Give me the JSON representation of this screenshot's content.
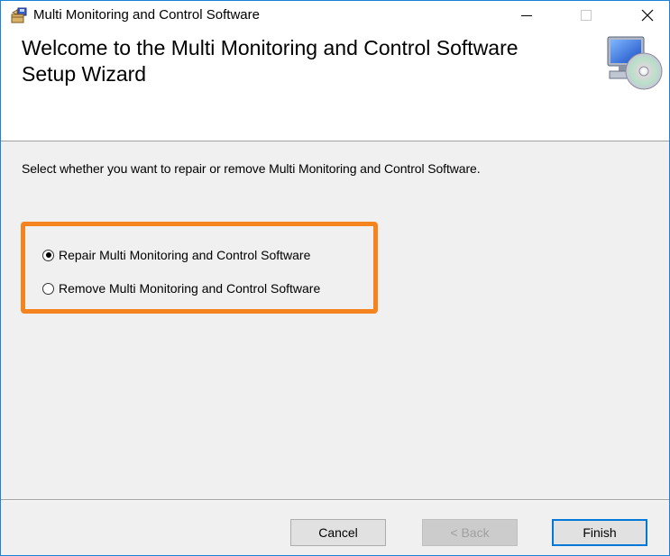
{
  "window": {
    "title": "Multi Monitoring and Control Software",
    "icons": {
      "app": "installer-icon",
      "minimize": "minimize-icon",
      "maximize": "maximize-icon",
      "close": "close-icon"
    }
  },
  "header": {
    "title": "Welcome to the Multi Monitoring and Control Software Setup Wizard",
    "icon": "computer-cd-icon"
  },
  "body": {
    "instruction": "Select whether you want to repair or remove Multi Monitoring and Control Software.",
    "options": [
      {
        "label": "Repair Multi Monitoring and Control Software",
        "selected": true
      },
      {
        "label": "Remove Multi Monitoring and Control Software",
        "selected": false
      }
    ],
    "highlight_color": "#f5841f"
  },
  "footer": {
    "cancel_label": "Cancel",
    "back_label": "< Back",
    "back_enabled": false,
    "finish_label": "Finish"
  }
}
